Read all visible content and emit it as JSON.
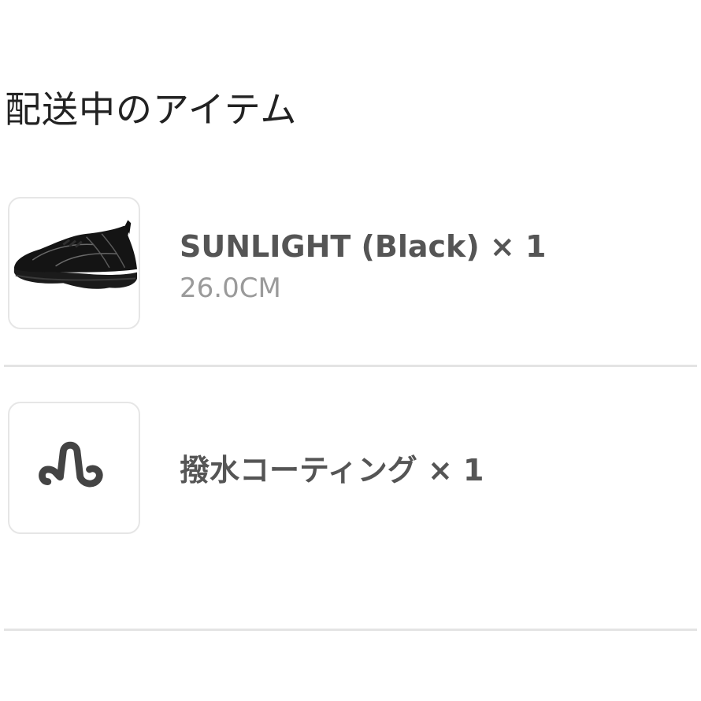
{
  "section": {
    "title": "配送中のアイテム"
  },
  "items": [
    {
      "name": "SUNLIGHT (Black) × 1",
      "size": "26.0CM",
      "thumbnail_icon": "black-sneaker-image"
    },
    {
      "name": "撥水コーティング × 1",
      "thumbnail_icon": "water-repellent-coating-icon"
    }
  ]
}
